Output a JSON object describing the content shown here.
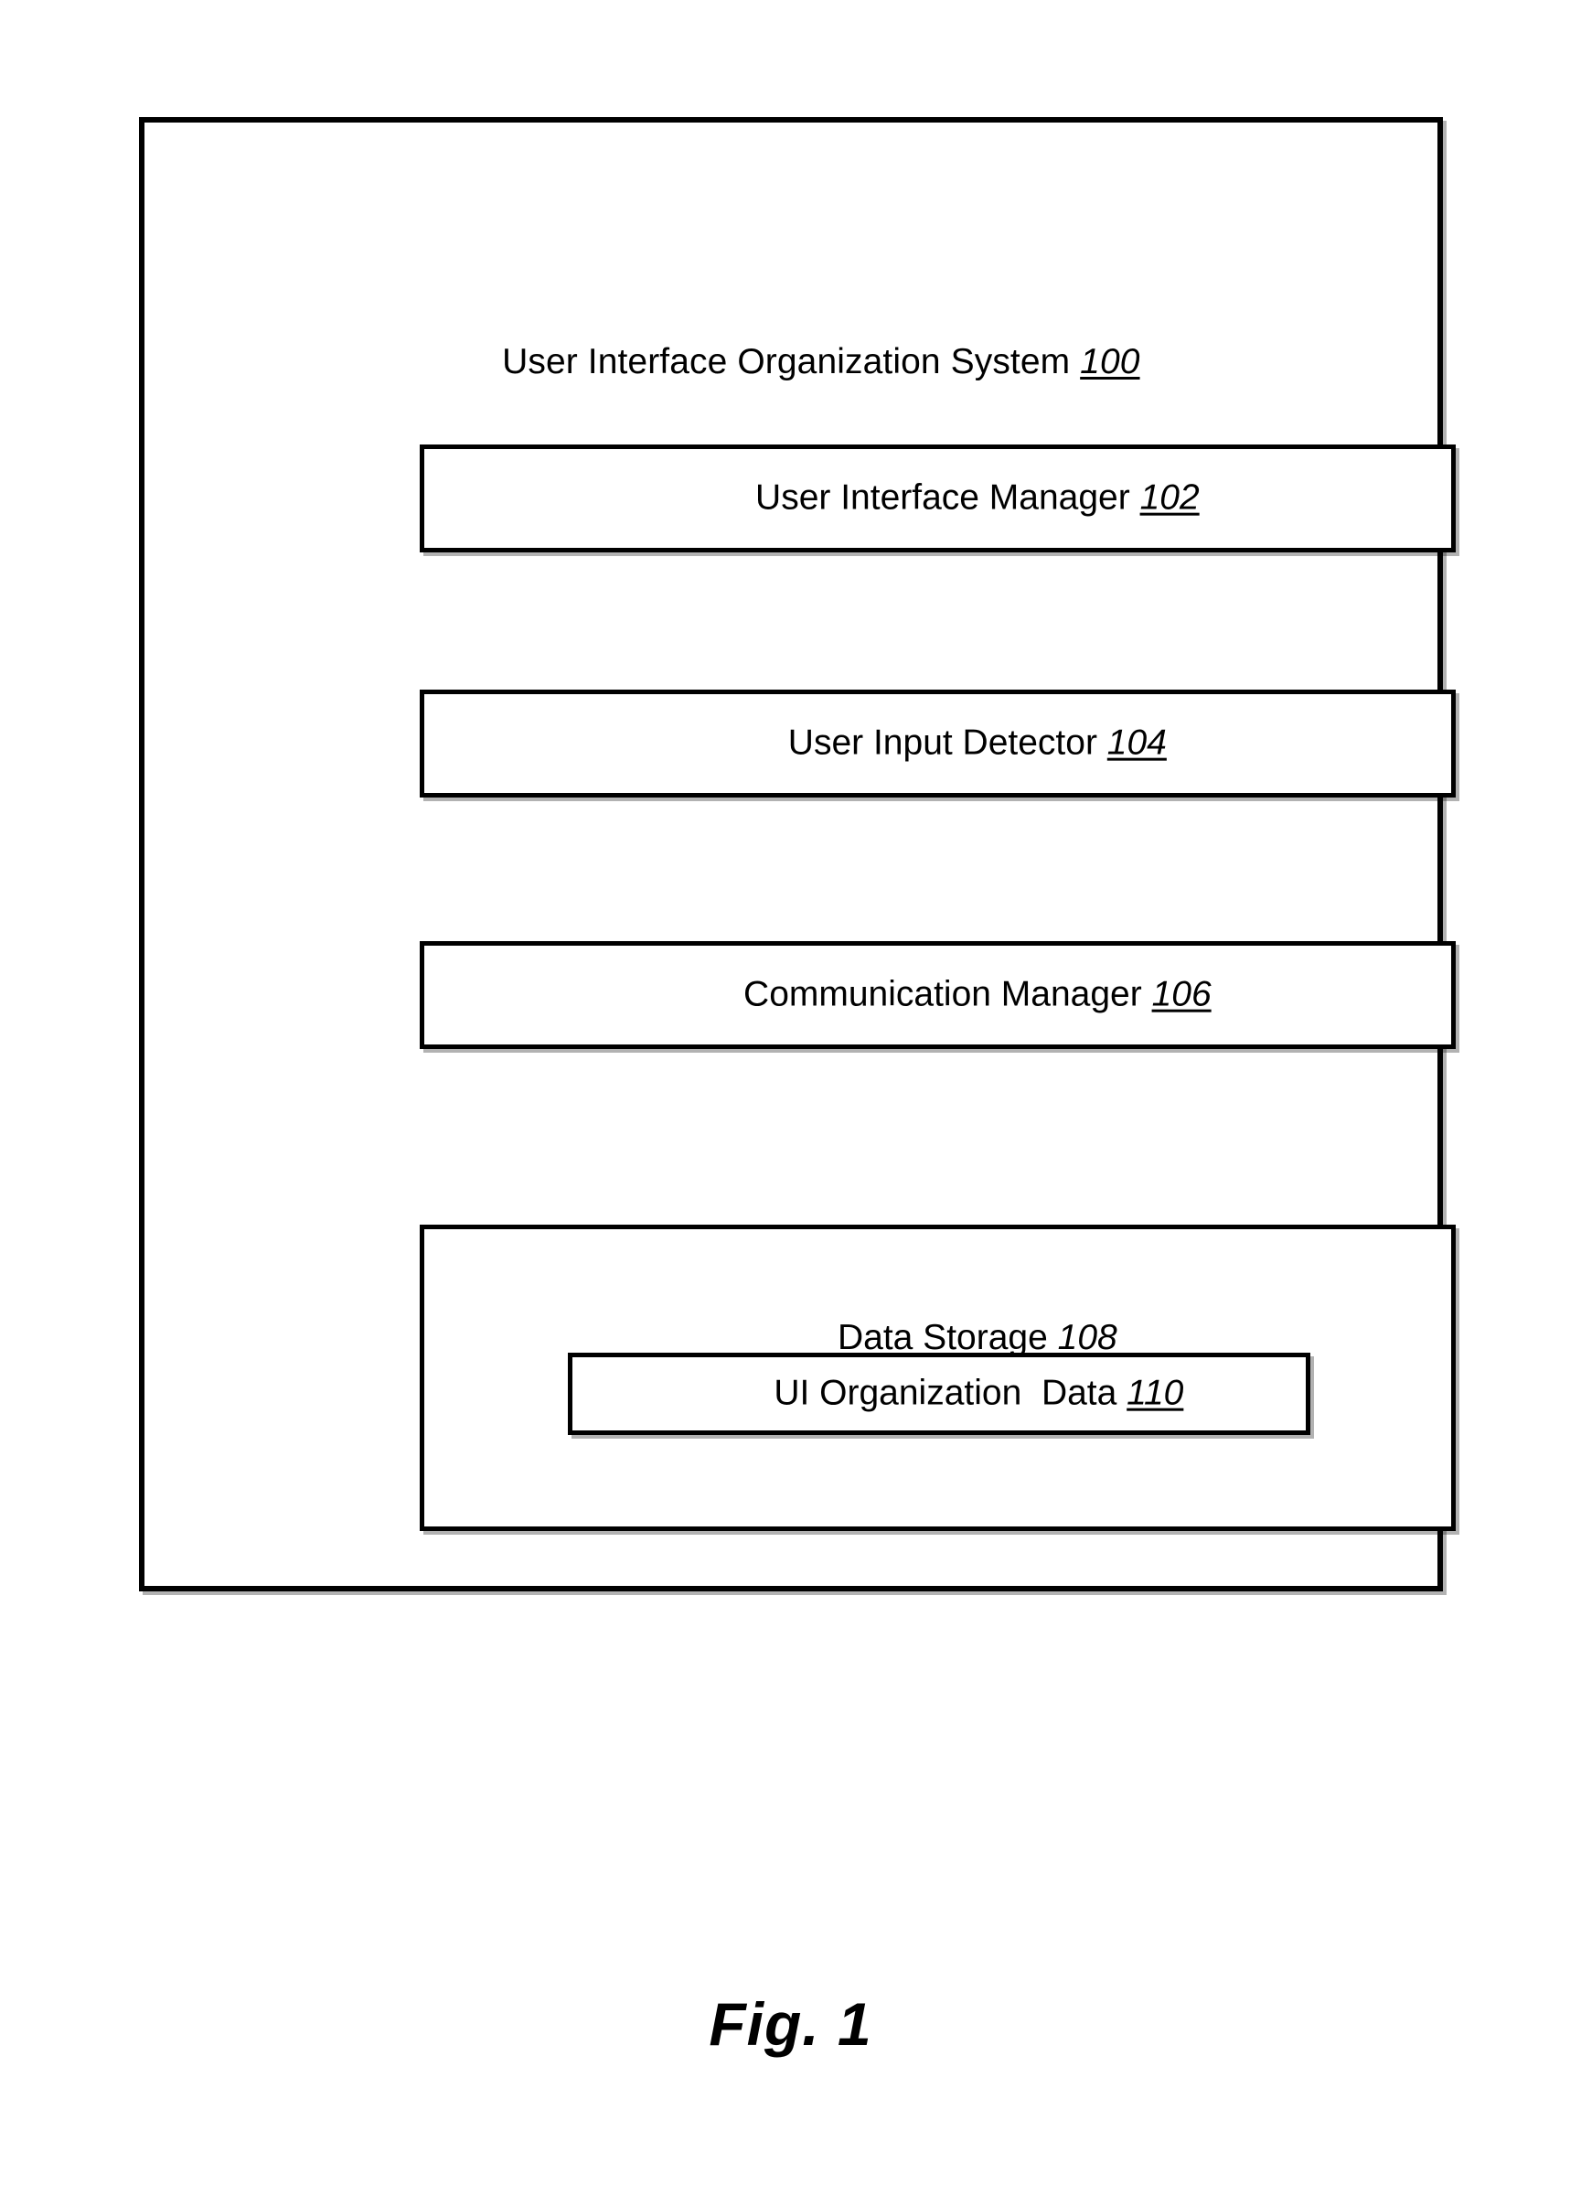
{
  "figure": {
    "caption": "Fig. 1",
    "system": {
      "title_text": "User Interface Organization System",
      "title_ref": "100"
    },
    "components": [
      {
        "id": "ui-manager",
        "label": "User Interface Manager",
        "ref": "102"
      },
      {
        "id": "input-detector",
        "label": "User Input Detector",
        "ref": "104"
      },
      {
        "id": "comm-manager",
        "label": "Communication Manager",
        "ref": "106"
      },
      {
        "id": "data-storage",
        "label": "Data Storage",
        "ref": "108",
        "children": [
          {
            "id": "ui-org-data",
            "label": "UI Organization  Data",
            "ref": "110"
          }
        ]
      }
    ],
    "colors": {
      "line": "#000000",
      "background": "#ffffff",
      "text": "#000000"
    }
  }
}
